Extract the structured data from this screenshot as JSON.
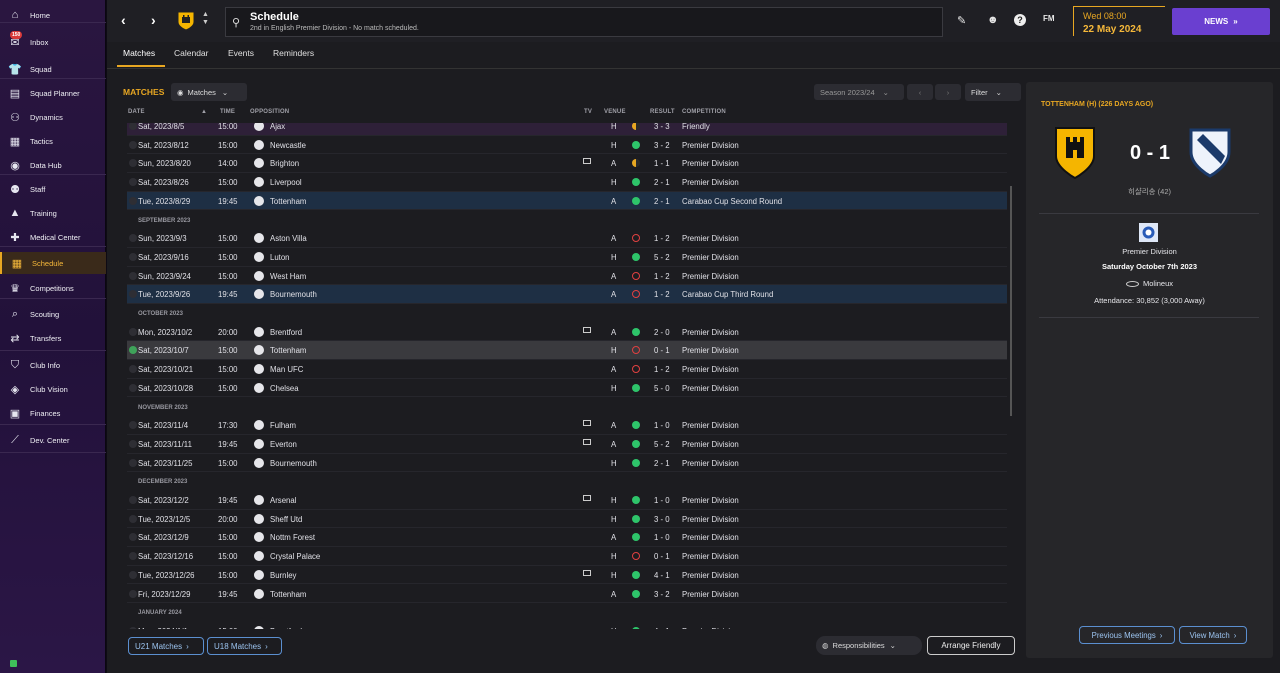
{
  "sidebar": {
    "inbox_badge": "150",
    "items": [
      {
        "label": "Home",
        "icon": "home-icon"
      },
      {
        "label": "Inbox",
        "icon": "inbox-icon"
      },
      {
        "label": "Squad",
        "icon": "shirt-icon"
      },
      {
        "label": "Squad Planner",
        "icon": "clipboard-icon"
      },
      {
        "label": "Dynamics",
        "icon": "people-icon"
      },
      {
        "label": "Tactics",
        "icon": "tactics-board-icon"
      },
      {
        "label": "Data Hub",
        "icon": "data-icon"
      },
      {
        "label": "Staff",
        "icon": "staff-icon"
      },
      {
        "label": "Training",
        "icon": "training-cone-icon"
      },
      {
        "label": "Medical Center",
        "icon": "medical-icon"
      },
      {
        "label": "Schedule",
        "icon": "calendar-icon"
      },
      {
        "label": "Competitions",
        "icon": "trophy-icon"
      },
      {
        "label": "Scouting",
        "icon": "scouting-icon"
      },
      {
        "label": "Transfers",
        "icon": "transfers-icon"
      },
      {
        "label": "Club Info",
        "icon": "shield-icon"
      },
      {
        "label": "Club Vision",
        "icon": "vision-icon"
      },
      {
        "label": "Finances",
        "icon": "finances-icon"
      },
      {
        "label": "Dev. Center",
        "icon": "dev-center-icon"
      }
    ]
  },
  "header": {
    "title": "Schedule",
    "subtitle": "2nd in English Premier Division - No match scheduled.",
    "fm_label": "FM",
    "time": "Wed 08:00",
    "date": "22 May 2024",
    "news_label": "NEWS"
  },
  "tabs": [
    "Matches",
    "Calendar",
    "Events",
    "Reminders"
  ],
  "matches_panel": {
    "title": "MATCHES",
    "view_dropdown": "Matches",
    "season": "Season 2023/24",
    "filter": "Filter",
    "columns": {
      "date": "DATE",
      "time": "TIME",
      "opposition": "OPPOSITION",
      "tv": "TV",
      "venue": "VENUE",
      "result": "RESULT",
      "competition": "COMPETITION"
    },
    "rows": [
      {
        "type": "match",
        "date": "Sat, 2023/8/5",
        "time": "15:00",
        "opp": "Ajax",
        "tv": false,
        "venue": "H",
        "res": "D",
        "score": "3 - 3",
        "comp": "Friendly",
        "style": "top"
      },
      {
        "type": "match",
        "date": "Sat, 2023/8/12",
        "time": "15:00",
        "opp": "Newcastle",
        "tv": false,
        "venue": "H",
        "res": "W",
        "score": "3 - 2",
        "comp": "Premier Division"
      },
      {
        "type": "match",
        "date": "Sun, 2023/8/20",
        "time": "14:00",
        "opp": "Brighton",
        "tv": true,
        "venue": "A",
        "res": "D",
        "score": "1 - 1",
        "comp": "Premier Division"
      },
      {
        "type": "match",
        "date": "Sat, 2023/8/26",
        "time": "15:00",
        "opp": "Liverpool",
        "tv": false,
        "venue": "H",
        "res": "W",
        "score": "2 - 1",
        "comp": "Premier Division"
      },
      {
        "type": "match",
        "date": "Tue, 2023/8/29",
        "time": "19:45",
        "opp": "Tottenham",
        "tv": false,
        "venue": "A",
        "res": "W",
        "score": "2 - 1",
        "comp": "Carabao Cup Second Round",
        "style": "hl"
      },
      {
        "type": "month",
        "label": "SEPTEMBER 2023"
      },
      {
        "type": "match",
        "date": "Sun, 2023/9/3",
        "time": "15:00",
        "opp": "Aston Villa",
        "tv": false,
        "venue": "A",
        "res": "L",
        "score": "1 - 2",
        "comp": "Premier Division"
      },
      {
        "type": "match",
        "date": "Sat, 2023/9/16",
        "time": "15:00",
        "opp": "Luton",
        "tv": false,
        "venue": "H",
        "res": "W",
        "score": "5 - 2",
        "comp": "Premier Division"
      },
      {
        "type": "match",
        "date": "Sun, 2023/9/24",
        "time": "15:00",
        "opp": "West Ham",
        "tv": false,
        "venue": "A",
        "res": "L",
        "score": "1 - 2",
        "comp": "Premier Division"
      },
      {
        "type": "match",
        "date": "Tue, 2023/9/26",
        "time": "19:45",
        "opp": "Bournemouth",
        "tv": false,
        "venue": "A",
        "res": "L",
        "score": "1 - 2",
        "comp": "Carabao Cup Third Round",
        "style": "hl"
      },
      {
        "type": "month",
        "label": "OCTOBER 2023"
      },
      {
        "type": "match",
        "date": "Mon, 2023/10/2",
        "time": "20:00",
        "opp": "Brentford",
        "tv": true,
        "venue": "A",
        "res": "W",
        "score": "2 - 0",
        "comp": "Premier Division"
      },
      {
        "type": "match",
        "date": "Sat, 2023/10/7",
        "time": "15:00",
        "opp": "Tottenham",
        "tv": false,
        "venue": "H",
        "res": "L",
        "score": "0 - 1",
        "comp": "Premier Division",
        "style": "sel",
        "done": true
      },
      {
        "type": "match",
        "date": "Sat, 2023/10/21",
        "time": "15:00",
        "opp": "Man UFC",
        "tv": false,
        "venue": "A",
        "res": "L",
        "score": "1 - 2",
        "comp": "Premier Division"
      },
      {
        "type": "match",
        "date": "Sat, 2023/10/28",
        "time": "15:00",
        "opp": "Chelsea",
        "tv": false,
        "venue": "H",
        "res": "W",
        "score": "5 - 0",
        "comp": "Premier Division"
      },
      {
        "type": "month",
        "label": "NOVEMBER 2023"
      },
      {
        "type": "match",
        "date": "Sat, 2023/11/4",
        "time": "17:30",
        "opp": "Fulham",
        "tv": true,
        "venue": "A",
        "res": "W",
        "score": "1 - 0",
        "comp": "Premier Division"
      },
      {
        "type": "match",
        "date": "Sat, 2023/11/11",
        "time": "19:45",
        "opp": "Everton",
        "tv": true,
        "venue": "A",
        "res": "W",
        "score": "5 - 2",
        "comp": "Premier Division"
      },
      {
        "type": "match",
        "date": "Sat, 2023/11/25",
        "time": "15:00",
        "opp": "Bournemouth",
        "tv": false,
        "venue": "H",
        "res": "W",
        "score": "2 - 1",
        "comp": "Premier Division"
      },
      {
        "type": "month",
        "label": "DECEMBER 2023"
      },
      {
        "type": "match",
        "date": "Sat, 2023/12/2",
        "time": "19:45",
        "opp": "Arsenal",
        "tv": true,
        "venue": "H",
        "res": "W",
        "score": "1 - 0",
        "comp": "Premier Division"
      },
      {
        "type": "match",
        "date": "Tue, 2023/12/5",
        "time": "20:00",
        "opp": "Sheff Utd",
        "tv": false,
        "venue": "H",
        "res": "W",
        "score": "3 - 0",
        "comp": "Premier Division"
      },
      {
        "type": "match",
        "date": "Sat, 2023/12/9",
        "time": "15:00",
        "opp": "Nottm Forest",
        "tv": false,
        "venue": "A",
        "res": "W",
        "score": "1 - 0",
        "comp": "Premier Division"
      },
      {
        "type": "match",
        "date": "Sat, 2023/12/16",
        "time": "15:00",
        "opp": "Crystal Palace",
        "tv": false,
        "venue": "H",
        "res": "L",
        "score": "0 - 1",
        "comp": "Premier Division"
      },
      {
        "type": "match",
        "date": "Tue, 2023/12/26",
        "time": "15:00",
        "opp": "Burnley",
        "tv": true,
        "venue": "H",
        "res": "W",
        "score": "4 - 1",
        "comp": "Premier Division"
      },
      {
        "type": "match",
        "date": "Fri, 2023/12/29",
        "time": "19:45",
        "opp": "Tottenham",
        "tv": false,
        "venue": "A",
        "res": "W",
        "score": "3 - 2",
        "comp": "Premier Division"
      },
      {
        "type": "month",
        "label": "JANUARY 2024"
      },
      {
        "type": "match",
        "date": "Mon, 2024/1/1",
        "time": "15:00",
        "opp": "Brentford",
        "tv": false,
        "venue": "H",
        "res": "W",
        "score": "4 - 1",
        "comp": "Premier Division"
      }
    ],
    "u21_button": "U21 Matches",
    "u18_button": "U18 Matches",
    "responsibilities": "Responsibilities",
    "arrange_friendly": "Arrange Friendly"
  },
  "match_detail": {
    "title": "TOTTENHAM (H) (226 DAYS AGO)",
    "score": "0 - 1",
    "scorer": "히샬리송 (42)",
    "competition": "Premier Division",
    "date": "Saturday October 7th 2023",
    "stadium": "Molineux",
    "attendance": "Attendance: 30,852 (3,000 Away)",
    "previous_meetings": "Previous Meetings",
    "view_match": "View Match"
  },
  "colors": {
    "accent": "#e8a722",
    "news": "#6a3fd0",
    "win": "#2ec46a",
    "loss": "#e04040",
    "link": "#5b8fd0"
  }
}
